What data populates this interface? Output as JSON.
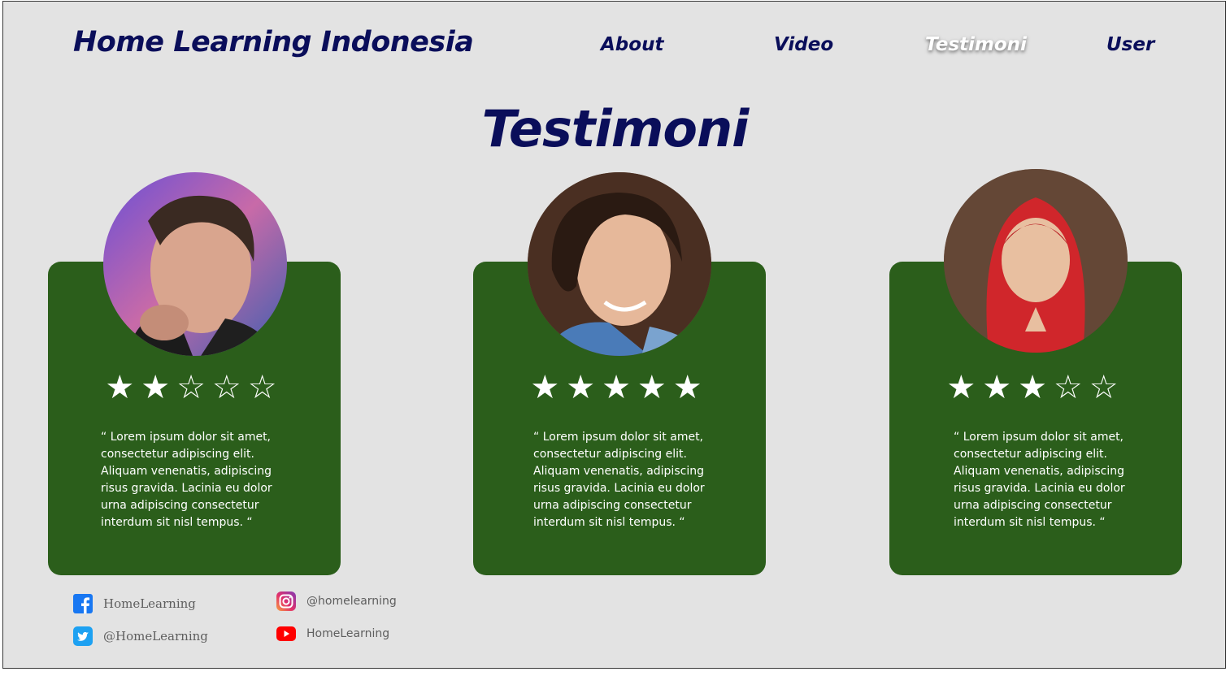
{
  "header": {
    "brand": "Home Learning Indonesia",
    "nav": [
      {
        "label": "About",
        "active": false
      },
      {
        "label": "Video",
        "active": false
      },
      {
        "label": "Testimoni",
        "active": true
      },
      {
        "label": "User",
        "active": false
      }
    ]
  },
  "page_title": "Testimoni",
  "testimonials": [
    {
      "rating": 2,
      "max": 5,
      "stars": "★★☆☆☆",
      "quote": "“ Lorem ipsum dolor sit amet, consectetur adipiscing elit. Aliquam venenatis, adipiscing risus gravida. Lacinia eu dolor urna adipiscing consectetur interdum sit nisl tempus. “"
    },
    {
      "rating": 5,
      "max": 5,
      "stars": "★★★★★",
      "quote": "“ Lorem ipsum dolor sit amet, consectetur adipiscing elit. Aliquam venenatis, adipiscing risus gravida. Lacinia eu dolor urna adipiscing consectetur interdum sit nisl tempus. “"
    },
    {
      "rating": 3,
      "max": 5,
      "stars": "★★★☆☆",
      "quote": "“ Lorem ipsum dolor sit amet, consectetur adipiscing elit. Aliquam venenatis, adipiscing risus gravida. Lacinia eu dolor urna adipiscing consectetur interdum sit nisl tempus. “"
    }
  ],
  "social": {
    "facebook": {
      "icon": "facebook-icon",
      "label": "HomeLearning"
    },
    "twitter": {
      "icon": "twitter-icon",
      "label": "@HomeLearning"
    },
    "instagram": {
      "icon": "instagram-icon",
      "label": "@homelearning"
    },
    "youtube": {
      "icon": "youtube-icon",
      "label": "HomeLearning"
    }
  },
  "colors": {
    "background": "#e3e3e3",
    "heading": "#0a0e5a",
    "card": "#2b5e1b",
    "text_on_card": "#ffffff",
    "facebook": "#1877f2",
    "twitter": "#1da1f2",
    "youtube": "#ff0000"
  }
}
